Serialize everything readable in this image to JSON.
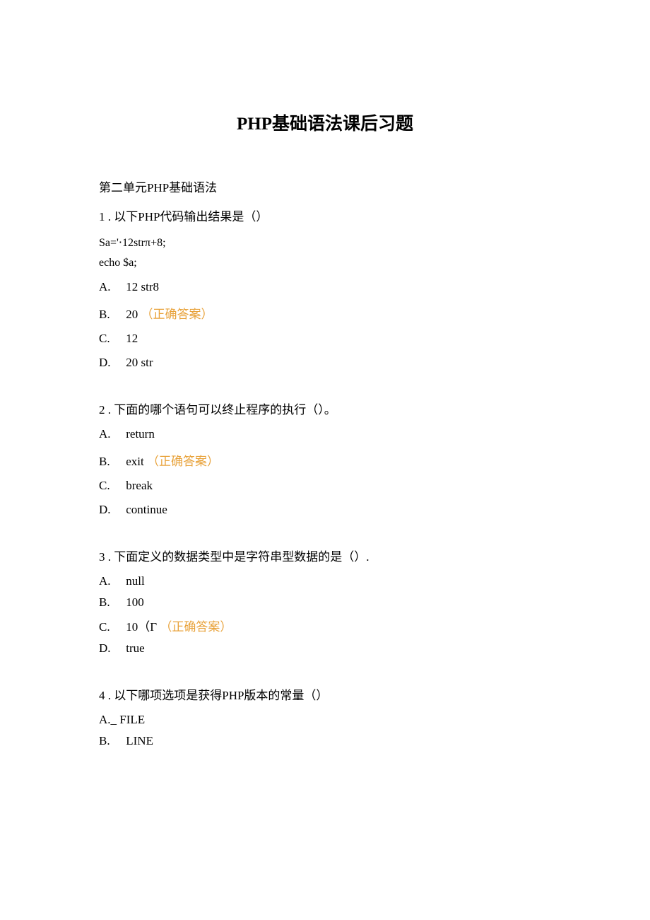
{
  "title": "PHP基础语法课后习题",
  "subtitle": "第二单元PHP基础语法",
  "correctLabel": "（正确答案）",
  "questions": {
    "q1": {
      "header": "1  . 以下PHP代码输出结果是（）",
      "code1": "Sa='⋅12strπ+8;",
      "code2": "echo $a;",
      "optA": {
        "letter": "A.",
        "text": "12 str8"
      },
      "optB": {
        "letter": "B.",
        "text": "20"
      },
      "optC": {
        "letter": "C.",
        "text": "12"
      },
      "optD": {
        "letter": "D.",
        "text": "20 str"
      }
    },
    "q2": {
      "header": "2  . 下面的哪个语句可以终止程序的执行（）。",
      "optA": {
        "letter": "A.",
        "text": "return"
      },
      "optB": {
        "letter": "B.",
        "text": "exit"
      },
      "optC": {
        "letter": "C.",
        "text": "break"
      },
      "optD": {
        "letter": "D.",
        "text": "continue"
      }
    },
    "q3": {
      "header": "3  . 下面定义的数据类型中是字符串型数据的是（）.",
      "optA": {
        "letter": "A.",
        "text": "null"
      },
      "optB": {
        "letter": "B.",
        "text": "100"
      },
      "optC": {
        "letter": "C.",
        "text": "10（Γ"
      },
      "optD": {
        "letter": "D.",
        "text": "true"
      }
    },
    "q4": {
      "header": "4  . 以下哪项选项是获得PHP版本的常量（）",
      "optA": {
        "letter": "A._",
        "text": " FILE"
      },
      "optB": {
        "letter": "B.",
        "text": "LINE"
      }
    }
  }
}
